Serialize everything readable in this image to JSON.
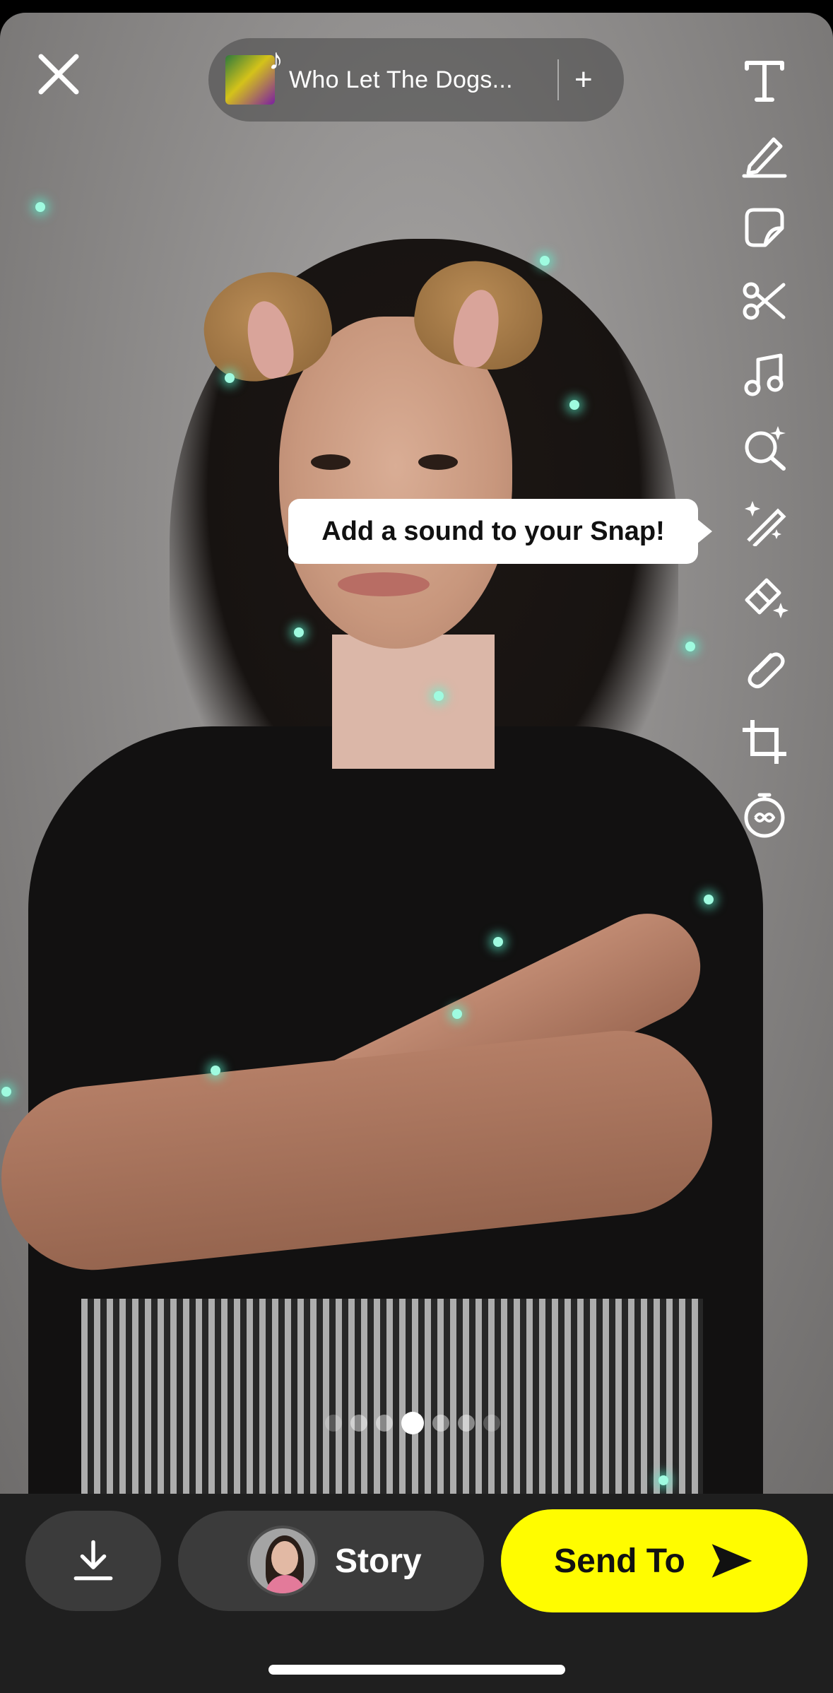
{
  "music": {
    "song_title": "Who Let The Dogs...",
    "add_label": "+"
  },
  "tooltip": {
    "text": "Add a sound to your Snap!"
  },
  "toolbar": {
    "tools": [
      "text-icon",
      "pencil-icon",
      "sticker-icon",
      "scissors-icon",
      "music-note-icon",
      "lens-search-icon",
      "magic-wand-icon",
      "eraser-sparkle-icon",
      "paperclip-icon",
      "crop-icon",
      "timer-loop-icon"
    ]
  },
  "pager": {
    "total": 7,
    "active": 3
  },
  "bottom_bar": {
    "story_label": "Story",
    "send_label": "Send To"
  },
  "colors": {
    "send_button": "#fffc00",
    "bottom_bar": "#1f1f1f",
    "pill_bg": "#3b3b3b"
  }
}
